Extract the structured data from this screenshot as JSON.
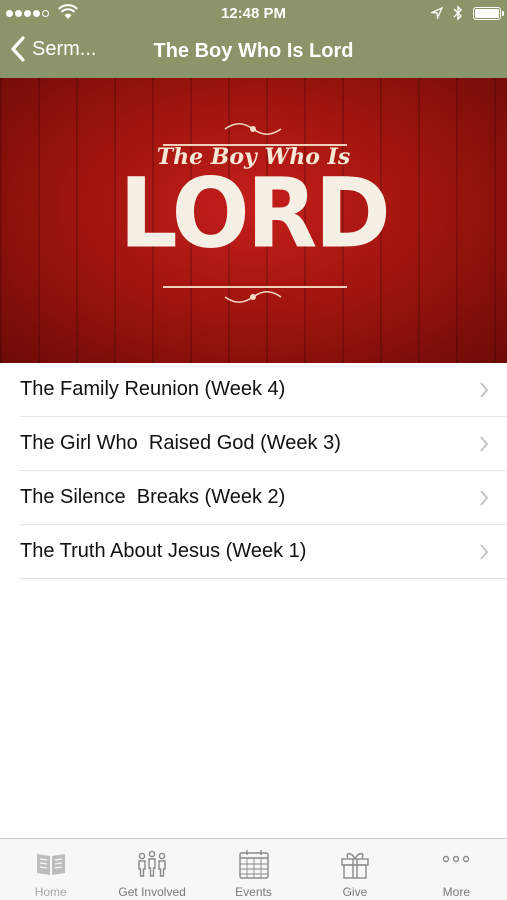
{
  "status_bar": {
    "time": "12:48 PM"
  },
  "nav": {
    "back_label": "Serm...",
    "title": "The Boy Who Is Lord"
  },
  "banner": {
    "subtitle": "The Boy Who Is",
    "main": "LORD"
  },
  "sermons": [
    {
      "label": "The Family Reunion (Week 4)"
    },
    {
      "label": "The Girl Who  Raised God (Week 3)"
    },
    {
      "label": "The Silence  Breaks (Week 2)"
    },
    {
      "label": "The Truth About Jesus (Week 1)"
    }
  ],
  "tabs": [
    {
      "label": "Home",
      "icon": "book-icon"
    },
    {
      "label": "Get Involved",
      "icon": "people-icon"
    },
    {
      "label": "Events",
      "icon": "calendar-icon"
    },
    {
      "label": "Give",
      "icon": "gift-icon"
    },
    {
      "label": "More",
      "icon": "more-icon"
    }
  ],
  "colors": {
    "header": "#8a9669",
    "banner_red": "#a3150f",
    "tab_icon": "#8a8a8a"
  }
}
